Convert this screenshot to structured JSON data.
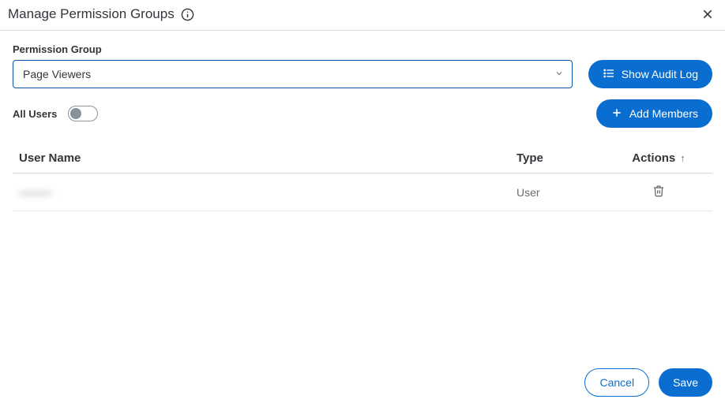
{
  "header": {
    "title": "Manage Permission Groups"
  },
  "form": {
    "permission_group_label": "Permission Group",
    "permission_group_value": "Page Viewers",
    "all_users_label": "All Users",
    "all_users_on": false
  },
  "buttons": {
    "show_audit_log": "Show Audit Log",
    "add_members": "Add Members",
    "cancel": "Cancel",
    "save": "Save"
  },
  "table": {
    "columns": {
      "user_name": "User Name",
      "type": "Type",
      "actions": "Actions"
    },
    "rows": [
      {
        "user_name": "———",
        "type": "User"
      }
    ]
  }
}
